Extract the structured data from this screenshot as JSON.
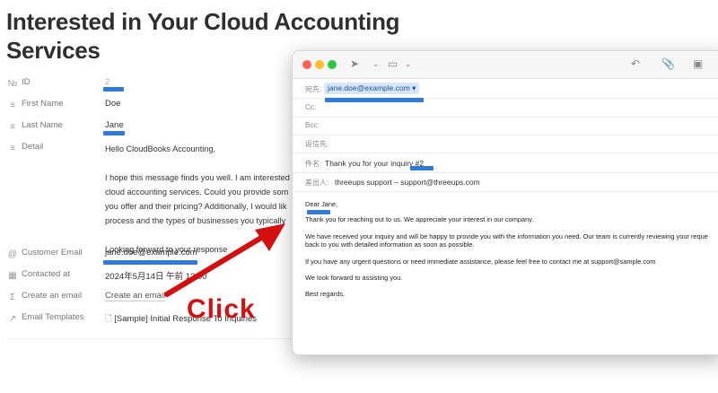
{
  "page": {
    "title_line1": "Interested in Your Cloud Accounting",
    "title_line2": "Services"
  },
  "properties": {
    "id": {
      "icon": "number-icon",
      "label": "ID",
      "value": "2"
    },
    "first_name": {
      "icon": "text-lines-icon",
      "label": "First Name",
      "value": "Doe"
    },
    "last_name": {
      "icon": "text-lines-icon",
      "label": "Last Name",
      "value": "Jane"
    },
    "detail": {
      "icon": "text-lines-icon",
      "label": "Detail",
      "lines": [
        "Hello CloudBooks Accounting,",
        "I hope this message finds you well. I am interested",
        "cloud accounting services. Could you provide som",
        "you offer and their pricing? Additionally, I would lik",
        "process and the types of businesses you typically",
        "Looking forward to your response"
      ]
    },
    "customer_email": {
      "icon": "at-icon",
      "label": "Customer Email",
      "value": "jane.doe@example.com"
    },
    "contacted_at": {
      "icon": "calendar-icon",
      "label": "Contacted at",
      "value": "2024年5月14日 午前 12:00"
    },
    "create_email": {
      "icon": "sigma-icon",
      "label": "Create an email",
      "value": "Create an email"
    },
    "email_templates": {
      "icon": "arrow-relation-icon",
      "label": "Email Templates",
      "value": "[Sample] Initial Response To Inquiries"
    }
  },
  "mail": {
    "to_label": "宛先:",
    "to_value": "jane.doe@example.com",
    "cc_label": "Cc:",
    "bcc_label": "Bcc:",
    "reply_label": "返信先:",
    "subject_label": "件名:",
    "subject_value": "Thank you for your inquiry #2",
    "from_label": "差出人:",
    "from_value": "threeups support – support@threeups.com",
    "body": {
      "greeting": "Dear Jane,",
      "line1": "Thank you for reaching out to us. We appreciate your interest in our company.",
      "line2a": "We have received your inquiry and will be happy to provide you with the information you need. Our team is currently reviewing your reque",
      "line2b": "back to you with detailed information as soon as possible.",
      "line3": "If you have any urgent questions or need immediate assistance, please feel free to contact me at support@sample.com",
      "line4": "We look forward to assisting you.",
      "closing": "Best regards,"
    }
  },
  "annotation": {
    "click_text": "Click"
  },
  "colors": {
    "redact": "#2f7bd9",
    "arrow": "#d40f0f",
    "chip": "#d8e6fb"
  }
}
